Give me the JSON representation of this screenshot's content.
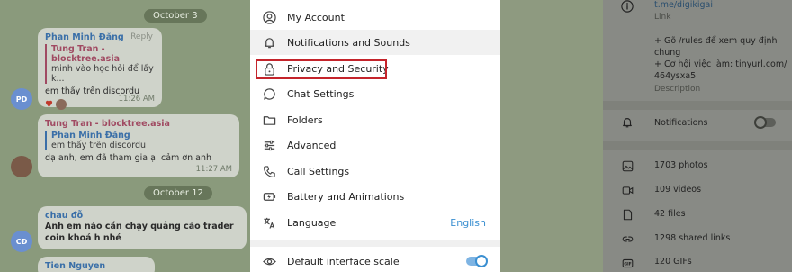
{
  "chat": {
    "date1": "October 3",
    "msg1": {
      "sender": "Phan Minh Đăng",
      "reply_label": "Reply",
      "quote_name": "Tung Tran - blocktree.asia",
      "quote_text": "minh vào học hỏi để lấy k...",
      "text": "em thấy trên discordu",
      "time": "11:26 AM",
      "avatar": "PD"
    },
    "msg2": {
      "sender": "Tung Tran - blocktree.asia",
      "quote_name": "Phan Minh Đăng",
      "quote_text": "em thấy trên discordu",
      "text": "dạ anh, em đã tham gia ạ. cảm ơn anh",
      "time": "11:27 AM"
    },
    "date2": "October 12",
    "msg3": {
      "sender": "chau đỗ",
      "text": "Anh em nào cần chạy quảng cáo trader coin khoá h nhé",
      "avatar": "CĐ"
    },
    "msg4": {
      "sender": "Tien Nguyen"
    }
  },
  "menu": {
    "items": [
      {
        "label": "My Account",
        "icon": "user-icon"
      },
      {
        "label": "Notifications and Sounds",
        "icon": "bell-icon"
      },
      {
        "label": "Privacy and Security",
        "icon": "lock-icon"
      },
      {
        "label": "Chat Settings",
        "icon": "chat-bubble-icon"
      },
      {
        "label": "Folders",
        "icon": "folder-icon"
      },
      {
        "label": "Advanced",
        "icon": "sliders-icon"
      },
      {
        "label": "Call Settings",
        "icon": "phone-icon"
      },
      {
        "label": "Battery and Animations",
        "icon": "battery-icon"
      },
      {
        "label": "Language",
        "icon": "translate-icon",
        "value": "English"
      }
    ],
    "scale": {
      "label": "Default interface scale",
      "icon": "eye-icon",
      "on": true
    },
    "accent_color": "#3a8fd1",
    "highlight_color": "#c4242b"
  },
  "info": {
    "link": "t.me/digikigai",
    "link_label": "Link",
    "desc_line1": "+ Gõ /rules để xem quy định",
    "desc_line2": "chung",
    "desc_line3": "+ Cơ hội việc làm: tinyurl.com/",
    "desc_line4": "464ysxa5",
    "desc_label": "Description",
    "notifications": "Notifications",
    "media": [
      {
        "label": "1703 photos",
        "icon": "photo-icon"
      },
      {
        "label": "109 videos",
        "icon": "video-icon"
      },
      {
        "label": "42 files",
        "icon": "file-icon"
      },
      {
        "label": "1298 shared links",
        "icon": "link-icon"
      },
      {
        "label": "120 GIFs",
        "icon": "gif-icon"
      }
    ]
  }
}
